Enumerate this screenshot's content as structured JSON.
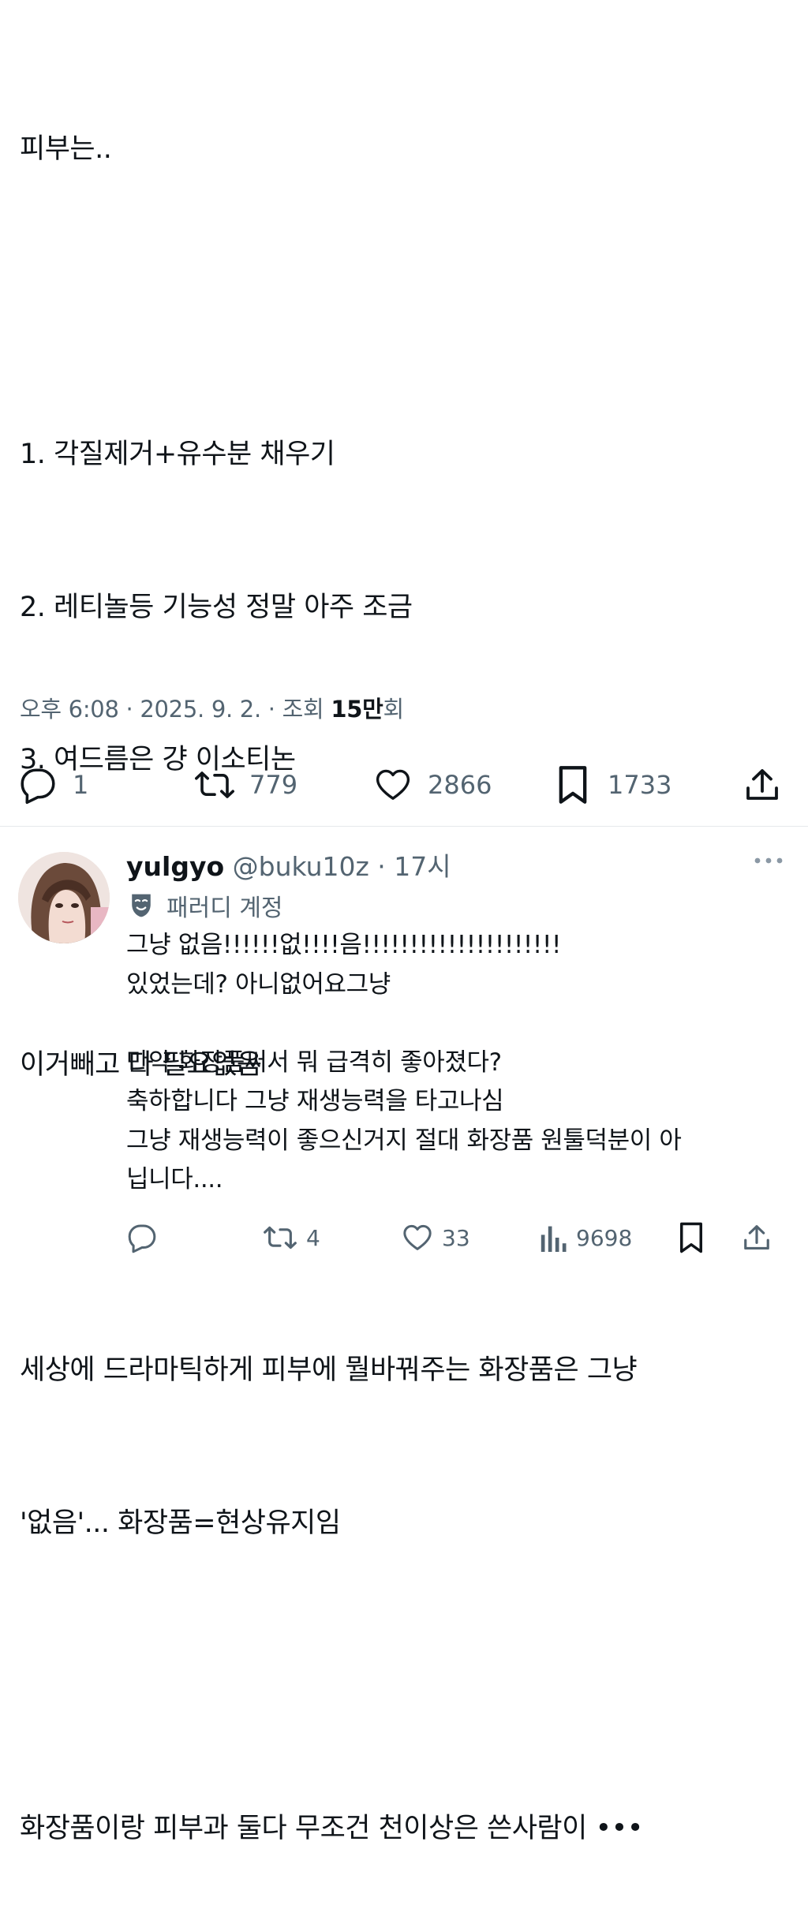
{
  "tweet": {
    "lines": [
      "피부는..",
      "",
      "1. 각질제거+유수분 채우기",
      "2. 레티놀등 기능성 정말 아주 조금",
      "3. 여드름은 걍 이소티논",
      "",
      "이거빼고 다 필요없음",
      "",
      "세상에 드라마틱하게 피부에 뭘바꿔주는 화장품은 그냥",
      "'없음'... 화장품=현상유지임",
      "",
      "화장품이랑 피부과 둘다 무조건 천이상은 쓴사람이 •••"
    ],
    "meta": {
      "time": "오후 6:08",
      "sep1": " · ",
      "date": "2025. 9. 2.",
      "sep2": " · ",
      "views_label": "조회 ",
      "views_value": "15만",
      "views_suffix": "회"
    },
    "actions": {
      "reply_icon": "reply-icon",
      "replies": "1",
      "retweet_icon": "retweet-icon",
      "retweets": "779",
      "like_icon": "heart-icon",
      "likes": "2866",
      "bookmark_icon": "bookmark-icon",
      "bookmarks": "1733",
      "share_icon": "share-icon"
    }
  },
  "reply": {
    "name": "yulgyo",
    "handle": "@buku10z · 17시",
    "badge": "패러디 계정",
    "lines": [
      "그냥 없음!!!!!!없!!!!음!!!!!!!!!!!!!!!!!!!!!",
      "있었는데? 아니없어요그냥",
      "",
      "만약 화장품써서 뭐 급격히 좋아졌다?",
      "축하합니다 그냥 재생능력을 타고나심",
      "그냥 재생능력이 좋으신거지 절대 화장품 원툴덕분이 아",
      "닙니다...."
    ],
    "actions": {
      "replies": "",
      "retweets": "4",
      "likes": "33",
      "views": "9698"
    }
  },
  "colors": {
    "text": "#0f1419",
    "secondary": "#536471",
    "divider": "#e6e9eb"
  }
}
